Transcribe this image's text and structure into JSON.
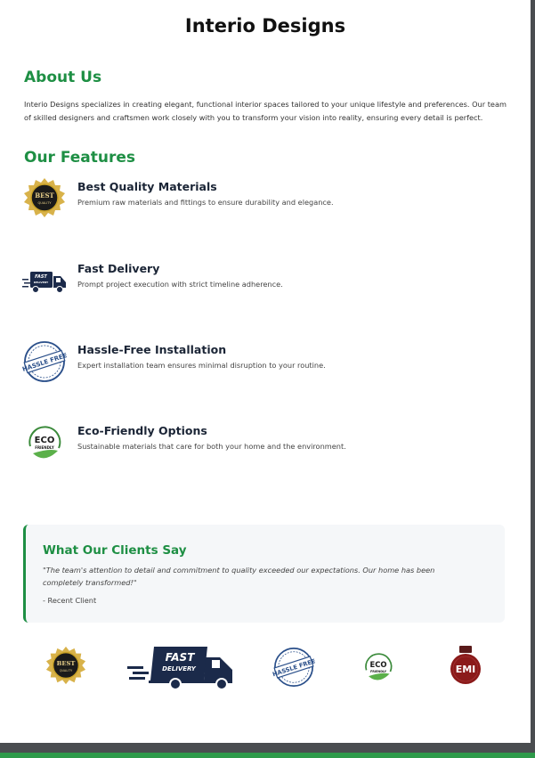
{
  "title": "Interio Designs",
  "about": {
    "heading": "About Us",
    "text": "Interio Designs specializes in creating elegant, functional interior spaces tailored to your unique lifestyle and preferences. Our team of skilled designers and craftsmen work closely with you to transform your vision into reality, ensuring every detail is perfect."
  },
  "features": {
    "heading": "Our Features",
    "items": [
      {
        "title": "Best Quality Materials",
        "description": "Premium raw materials and fittings to ensure durability and elegance.",
        "icon": "best-quality-badge-icon",
        "badge_text": [
          "BEST",
          "QUALITY"
        ]
      },
      {
        "title": "Fast Delivery",
        "description": "Prompt project execution with strict timeline adherence.",
        "icon": "fast-delivery-truck-icon",
        "badge_text": [
          "FAST",
          "DELIVERY"
        ]
      },
      {
        "title": "Hassle-Free Installation",
        "description": "Expert installation team ensures minimal disruption to your routine.",
        "icon": "hassle-free-stamp-icon",
        "badge_text": [
          "HASSLE FREE"
        ]
      },
      {
        "title": "Eco-Friendly Options",
        "description": "Sustainable materials that care for both your home and the environment.",
        "icon": "eco-friendly-leaf-icon",
        "badge_text": [
          "ECO",
          "FRIENDLY"
        ]
      }
    ]
  },
  "testimonial": {
    "heading": "What Our Clients Say",
    "quote": "\"The team's attention to detail and commitment to quality exceeded our expectations. Our home has been completely transformed!\"",
    "author": "- Recent Client"
  },
  "logos": [
    {
      "icon": "best-quality-badge-icon",
      "text": [
        "BEST",
        "QUALITY"
      ]
    },
    {
      "icon": "fast-delivery-truck-icon",
      "text": [
        "FAST",
        "DELIVERY"
      ]
    },
    {
      "icon": "hassle-free-stamp-icon",
      "text": [
        "HASSLE FREE"
      ]
    },
    {
      "icon": "eco-friendly-leaf-icon",
      "text": [
        "ECO",
        "FRIENDLY"
      ]
    },
    {
      "icon": "emi-tag-icon",
      "text": [
        "EMI"
      ]
    }
  ],
  "colors": {
    "accent_green": "#1e8f44",
    "navy": "#1b2a4a",
    "gold": "#c9a227",
    "emi_red": "#8b1a1a"
  }
}
